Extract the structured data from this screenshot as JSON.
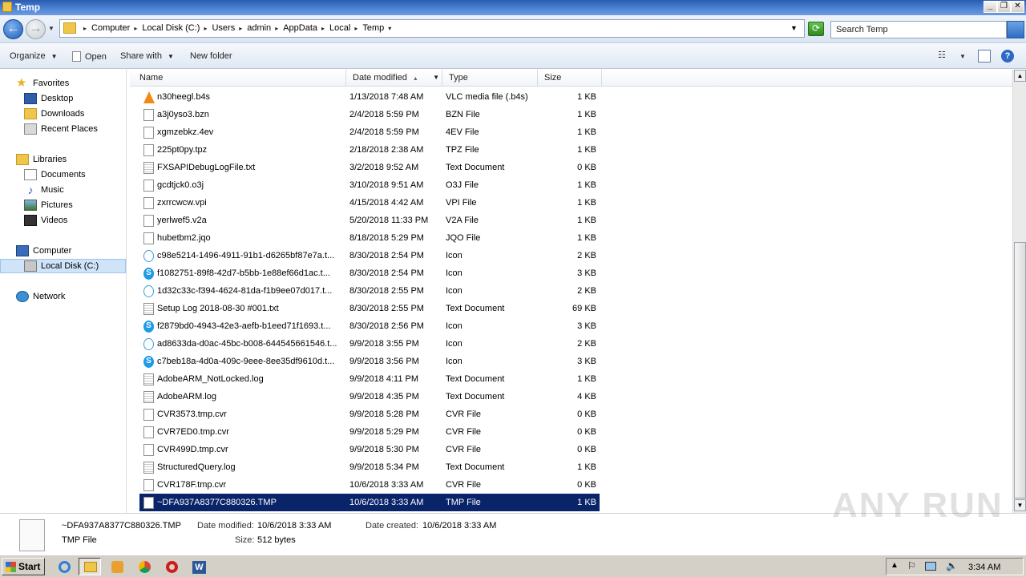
{
  "window": {
    "title": "Temp"
  },
  "address": {
    "crumbs": [
      "Computer",
      "Local Disk (C:)",
      "Users",
      "admin",
      "AppData",
      "Local",
      "Temp"
    ]
  },
  "search": {
    "placeholder": "Search Temp"
  },
  "toolbar": {
    "organize": "Organize",
    "open": "Open",
    "share_with": "Share with",
    "new_folder": "New folder"
  },
  "nav": {
    "favorites": "Favorites",
    "desktop": "Desktop",
    "downloads": "Downloads",
    "recent_places": "Recent Places",
    "libraries": "Libraries",
    "documents": "Documents",
    "music": "Music",
    "pictures": "Pictures",
    "videos": "Videos",
    "computer": "Computer",
    "local_disk": "Local Disk (C:)",
    "network": "Network"
  },
  "columns": {
    "name": "Name",
    "date": "Date modified",
    "type": "Type",
    "size": "Size"
  },
  "files": [
    {
      "icon": "vlc",
      "name": "n30heegl.b4s",
      "date": "1/13/2018 7:48 AM",
      "type": "VLC media file (.b4s)",
      "size": "1 KB"
    },
    {
      "icon": "doc",
      "name": "a3j0yso3.bzn",
      "date": "2/4/2018 5:59 PM",
      "type": "BZN File",
      "size": "1 KB"
    },
    {
      "icon": "doc",
      "name": "xgmzebkz.4ev",
      "date": "2/4/2018 5:59 PM",
      "type": "4EV File",
      "size": "1 KB"
    },
    {
      "icon": "doc",
      "name": "225pt0py.tpz",
      "date": "2/18/2018 2:38 AM",
      "type": "TPZ File",
      "size": "1 KB"
    },
    {
      "icon": "txt",
      "name": "FXSAPIDebugLogFile.txt",
      "date": "3/2/2018 9:52 AM",
      "type": "Text Document",
      "size": "0 KB"
    },
    {
      "icon": "doc",
      "name": "gcdtjck0.o3j",
      "date": "3/10/2018 9:51 AM",
      "type": "O3J File",
      "size": "1 KB"
    },
    {
      "icon": "doc",
      "name": "zxrrcwcw.vpi",
      "date": "4/15/2018 4:42 AM",
      "type": "VPI File",
      "size": "1 KB"
    },
    {
      "icon": "doc",
      "name": "yerlwef5.v2a",
      "date": "5/20/2018 11:33 PM",
      "type": "V2A File",
      "size": "1 KB"
    },
    {
      "icon": "doc",
      "name": "hubetbm2.jqo",
      "date": "8/18/2018 5:29 PM",
      "type": "JQO File",
      "size": "1 KB"
    },
    {
      "icon": "skype-light",
      "name": "c98e5214-1496-4911-91b1-d6265bf87e7a.t...",
      "date": "8/30/2018 2:54 PM",
      "type": "Icon",
      "size": "2 KB"
    },
    {
      "icon": "skype",
      "name": "f1082751-89f8-42d7-b5bb-1e88ef66d1ac.t...",
      "date": "8/30/2018 2:54 PM",
      "type": "Icon",
      "size": "3 KB"
    },
    {
      "icon": "skype-light",
      "name": "1d32c33c-f394-4624-81da-f1b9ee07d017.t...",
      "date": "8/30/2018 2:55 PM",
      "type": "Icon",
      "size": "2 KB"
    },
    {
      "icon": "txt",
      "name": "Setup Log 2018-08-30 #001.txt",
      "date": "8/30/2018 2:55 PM",
      "type": "Text Document",
      "size": "69 KB"
    },
    {
      "icon": "skype",
      "name": "f2879bd0-4943-42e3-aefb-b1eed71f1693.t...",
      "date": "8/30/2018 2:56 PM",
      "type": "Icon",
      "size": "3 KB"
    },
    {
      "icon": "skype-light",
      "name": "ad8633da-d0ac-45bc-b008-644545661546.t...",
      "date": "9/9/2018 3:55 PM",
      "type": "Icon",
      "size": "2 KB"
    },
    {
      "icon": "skype",
      "name": "c7beb18a-4d0a-409c-9eee-8ee35df9610d.t...",
      "date": "9/9/2018 3:56 PM",
      "type": "Icon",
      "size": "3 KB"
    },
    {
      "icon": "txt",
      "name": "AdobeARM_NotLocked.log",
      "date": "9/9/2018 4:11 PM",
      "type": "Text Document",
      "size": "1 KB"
    },
    {
      "icon": "txt",
      "name": "AdobeARM.log",
      "date": "9/9/2018 4:35 PM",
      "type": "Text Document",
      "size": "4 KB"
    },
    {
      "icon": "doc",
      "name": "CVR3573.tmp.cvr",
      "date": "9/9/2018 5:28 PM",
      "type": "CVR File",
      "size": "0 KB"
    },
    {
      "icon": "doc",
      "name": "CVR7ED0.tmp.cvr",
      "date": "9/9/2018 5:29 PM",
      "type": "CVR File",
      "size": "0 KB"
    },
    {
      "icon": "doc",
      "name": "CVR499D.tmp.cvr",
      "date": "9/9/2018 5:30 PM",
      "type": "CVR File",
      "size": "0 KB"
    },
    {
      "icon": "txt",
      "name": "StructuredQuery.log",
      "date": "9/9/2018 5:34 PM",
      "type": "Text Document",
      "size": "1 KB"
    },
    {
      "icon": "doc",
      "name": "CVR178F.tmp.cvr",
      "date": "10/6/2018 3:33 AM",
      "type": "CVR File",
      "size": "0 KB"
    },
    {
      "icon": "doc",
      "name": "~DFA937A8377C880326.TMP",
      "date": "10/6/2018 3:33 AM",
      "type": "TMP File",
      "size": "1 KB",
      "selected": true
    }
  ],
  "details": {
    "name": "~DFA937A8377C880326.TMP",
    "type": "TMP File",
    "date_modified_label": "Date modified:",
    "date_modified": "10/6/2018 3:33 AM",
    "date_created_label": "Date created:",
    "date_created": "10/6/2018 3:33 AM",
    "size_label": "Size:",
    "size": "512 bytes"
  },
  "watermark": "ANY RUN",
  "taskbar": {
    "start": "Start",
    "clock": "3:34 AM"
  },
  "colors": {
    "selection": "#0a246a",
    "titlebar": "#2a5db0",
    "accent": "#cfe3f9"
  }
}
